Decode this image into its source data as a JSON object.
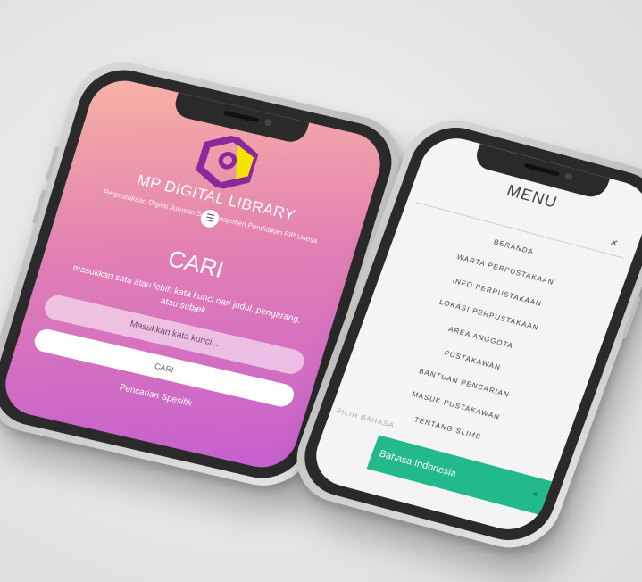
{
  "search_screen": {
    "library_title": "MP DIGITAL LIBRARY",
    "library_subtitle": "Perpustakaan Digital Jurusan S-1 Manajemen Pendidikan FIP Unesa",
    "heading": "CARI",
    "hint": "masukkan satu atau lebih kata kunci dari judul, pengarang, atau subjek",
    "search_placeholder": "Masukkan kata kunci...",
    "search_button": "CARI",
    "advanced_search": "Pencarian Spesifik",
    "menu_icon": "hamburger-icon",
    "gradient_colors": [
      "#f8b3a4",
      "#e27fb3",
      "#c45fd0"
    ]
  },
  "menu_screen": {
    "title": "MENU",
    "close": "×",
    "items": [
      {
        "label": "BERANDA"
      },
      {
        "label": "WARTA PERPUSTAKAAN"
      },
      {
        "label": "INFO PERPUSTAKAAN"
      },
      {
        "label": "LOKASI PERPUSTAKAAN"
      },
      {
        "label": "AREA ANGGOTA"
      },
      {
        "label": "PUSTAKAWAN"
      },
      {
        "label": "BANTUAN PENCARIAN"
      },
      {
        "label": "MASUK PUSTAKAWAN"
      },
      {
        "label": "TENTANG SLIMS"
      }
    ],
    "language_label": "PILIH BAHASA",
    "language_value": "Bahasa Indonesia",
    "language_close": "×",
    "accent_color": "#22b98c"
  }
}
